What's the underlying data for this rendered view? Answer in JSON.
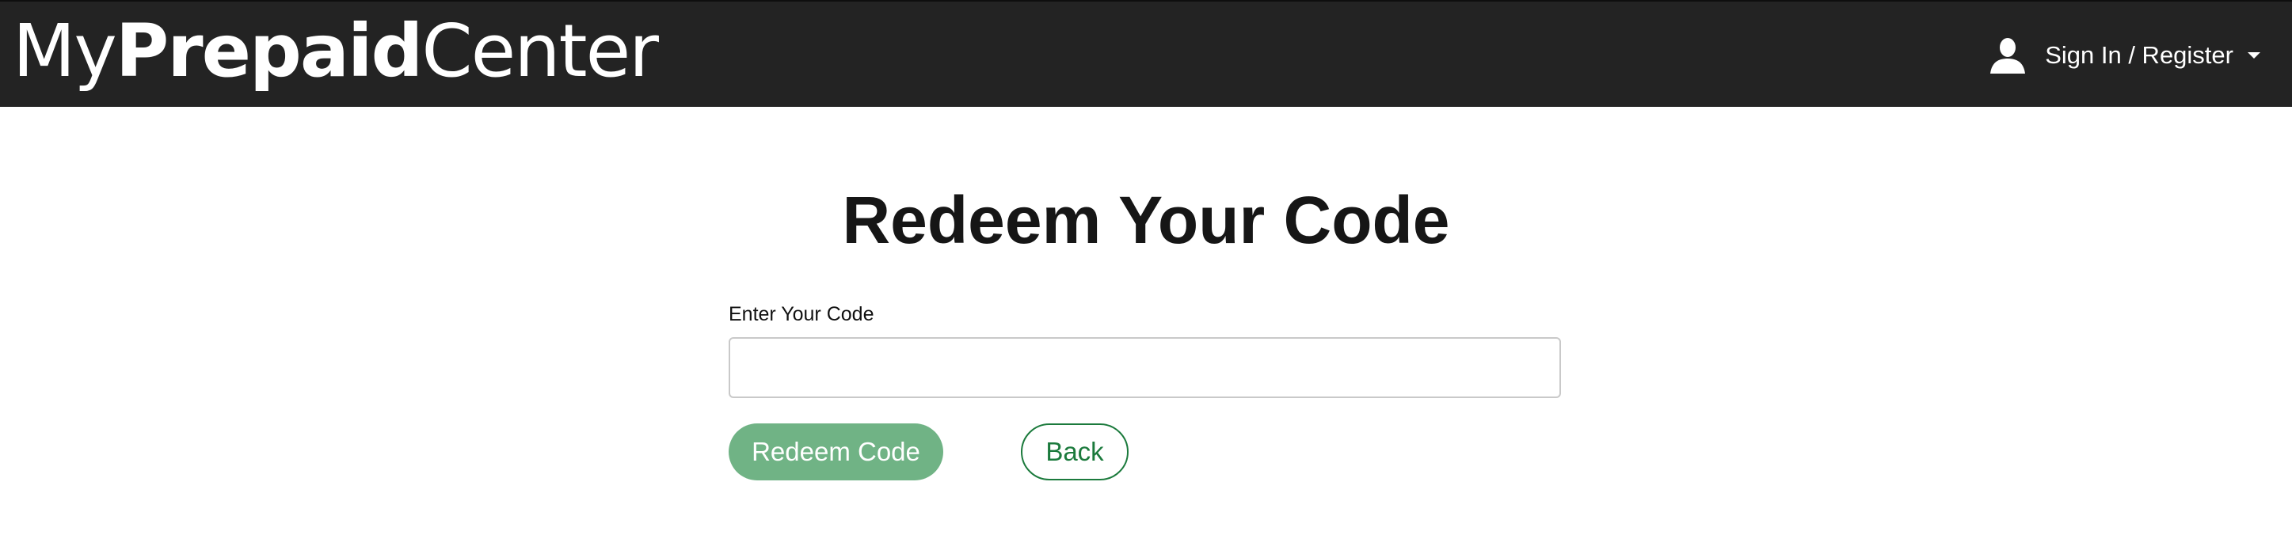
{
  "header": {
    "logo": {
      "part1": "My",
      "part2": "Prepaid",
      "part3": "Center"
    },
    "account": {
      "label": "Sign In / Register",
      "icon": "user-icon",
      "dropdown_icon": "caret-down-icon"
    }
  },
  "main": {
    "title": "Redeem Your Code",
    "code_field": {
      "label": "Enter Your Code",
      "value": "",
      "placeholder": ""
    },
    "redeem_button": {
      "label": "Redeem Code"
    },
    "back_button": {
      "label": "Back"
    }
  },
  "colors": {
    "header_bg": "#232323",
    "accent_green": "#1b7a3c",
    "disabled_green": "#70b385"
  }
}
